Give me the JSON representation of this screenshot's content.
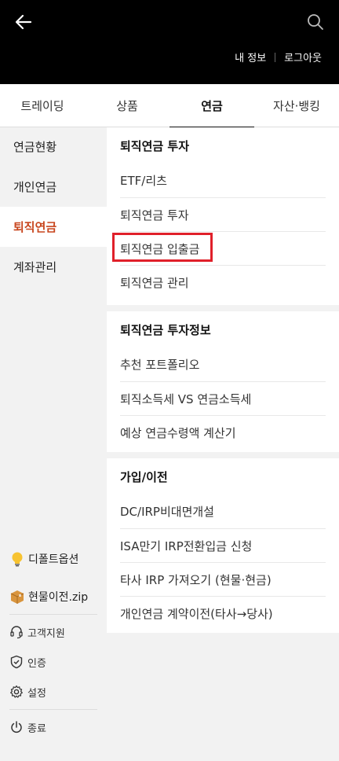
{
  "header": {
    "back_icon": "arrow-left-icon",
    "search_icon": "search-icon",
    "my_info": "내 정보",
    "logout": "로그아웃"
  },
  "tabs": [
    {
      "label": "트레이딩"
    },
    {
      "label": "상품"
    },
    {
      "label": "연금",
      "active": true
    },
    {
      "label": "자산·뱅킹"
    }
  ],
  "sidebar": {
    "items": [
      {
        "label": "연금현황"
      },
      {
        "label": "개인연금"
      },
      {
        "label": "퇴직연금",
        "active": true
      },
      {
        "label": "계좌관리"
      }
    ],
    "promos": [
      {
        "label": "디폴트옵션",
        "icon": "lightbulb-icon"
      },
      {
        "label": "현물이전.zip",
        "icon": "package-icon"
      }
    ],
    "utilities": [
      {
        "label": "고객지원",
        "icon": "headset-icon"
      },
      {
        "label": "인증",
        "icon": "shield-icon"
      },
      {
        "label": "설정",
        "icon": "gear-icon"
      }
    ],
    "exit": {
      "label": "종료",
      "icon": "power-icon"
    }
  },
  "sections": [
    {
      "title": "퇴직연금 투자",
      "items": [
        "ETF/리츠",
        "퇴직연금 투자",
        "퇴직연금 입출금",
        "퇴직연금 관리"
      ]
    },
    {
      "title": "퇴직연금 투자정보",
      "items": [
        "추천 포트폴리오",
        "퇴직소득세 VS 연금소득세",
        "예상 연금수령액 계산기"
      ]
    },
    {
      "title": "가입/이전",
      "items": [
        "DC/IRP비대면개설",
        "ISA만기 IRP전환입금 신청",
        "타사 IRP 가져오기 (현물·현금)",
        "개인연금 계약이전(타사→당사)"
      ]
    }
  ],
  "colors": {
    "accent": "#c8461e",
    "highlight": "#e0202a",
    "header_bg": "#000000"
  }
}
